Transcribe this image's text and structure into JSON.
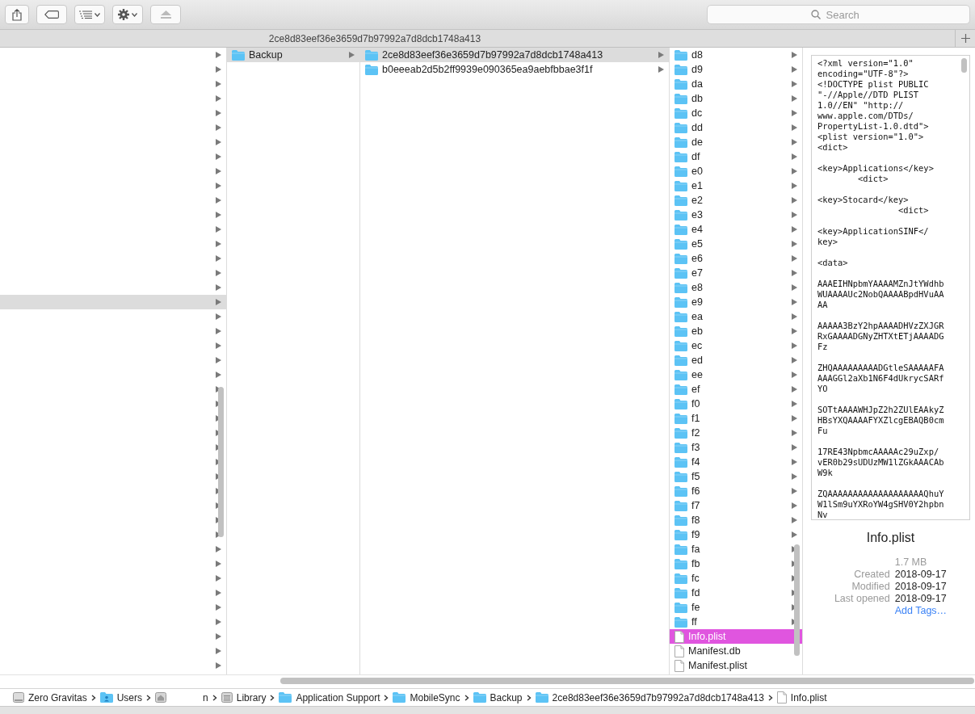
{
  "toolbar": {
    "search": {
      "placeholder": "Search"
    }
  },
  "path_title": "2ce8d83eef36e3659d7b97992a7d8dcb1748a413",
  "columns": [
    {
      "focused": false,
      "rows": [
        {
          "kind": "unnamed",
          "selected": false
        },
        {
          "kind": "unnamed",
          "selected": false
        },
        {
          "kind": "unnamed",
          "selected": false
        },
        {
          "kind": "unnamed",
          "selected": false
        },
        {
          "kind": "unnamed",
          "selected": false
        },
        {
          "kind": "unnamed",
          "selected": false
        },
        {
          "kind": "unnamed",
          "selected": false
        },
        {
          "kind": "unnamed",
          "selected": false
        },
        {
          "kind": "unnamed",
          "selected": false
        },
        {
          "kind": "unnamed",
          "selected": false
        },
        {
          "kind": "unnamed",
          "selected": false
        },
        {
          "kind": "unnamed",
          "selected": false
        },
        {
          "kind": "unnamed",
          "selected": false
        },
        {
          "kind": "unnamed",
          "selected": false
        },
        {
          "kind": "unnamed",
          "selected": false
        },
        {
          "kind": "unnamed",
          "selected": false
        },
        {
          "kind": "unnamed",
          "selected": false
        },
        {
          "kind": "unnamed",
          "selected": true
        },
        {
          "kind": "unnamed",
          "selected": false
        },
        {
          "kind": "unnamed",
          "selected": false
        },
        {
          "kind": "unnamed",
          "selected": false
        },
        {
          "kind": "unnamed",
          "selected": false
        },
        {
          "kind": "unnamed",
          "selected": false
        },
        {
          "kind": "unnamed",
          "selected": false
        },
        {
          "kind": "unnamed",
          "selected": false
        },
        {
          "kind": "unnamed",
          "selected": false
        },
        {
          "kind": "unnamed",
          "selected": false
        },
        {
          "kind": "unnamed",
          "selected": false
        },
        {
          "kind": "unnamed",
          "selected": false
        },
        {
          "kind": "unnamed",
          "selected": false
        },
        {
          "kind": "unnamed",
          "selected": false
        },
        {
          "kind": "unnamed",
          "selected": false
        },
        {
          "kind": "unnamed",
          "selected": false
        },
        {
          "kind": "unnamed",
          "selected": false
        },
        {
          "kind": "unnamed",
          "selected": false
        },
        {
          "kind": "unnamed",
          "selected": false
        },
        {
          "kind": "unnamed",
          "selected": false
        },
        {
          "kind": "unnamed",
          "selected": false
        },
        {
          "kind": "unnamed",
          "selected": false
        },
        {
          "kind": "unnamed",
          "selected": false
        },
        {
          "kind": "unnamed",
          "selected": false
        },
        {
          "kind": "unnamed",
          "selected": false
        },
        {
          "kind": "unnamed",
          "selected": false
        }
      ]
    },
    {
      "focused": false,
      "rows": [
        {
          "kind": "folder",
          "name": "Backup",
          "selected": true
        }
      ]
    },
    {
      "focused": false,
      "rows": [
        {
          "kind": "folder",
          "name": "2ce8d83eef36e3659d7b97992a7d8dcb1748a413",
          "selected": true
        },
        {
          "kind": "folder",
          "name": "b0eeeab2d5b2ff9939e090365ea9aebfbbae3f1f",
          "selected": false
        }
      ]
    },
    {
      "focused": true,
      "rows": [
        {
          "kind": "folder",
          "name": "d8",
          "selected": false
        },
        {
          "kind": "folder",
          "name": "d9",
          "selected": false
        },
        {
          "kind": "folder",
          "name": "da",
          "selected": false
        },
        {
          "kind": "folder",
          "name": "db",
          "selected": false
        },
        {
          "kind": "folder",
          "name": "dc",
          "selected": false
        },
        {
          "kind": "folder",
          "name": "dd",
          "selected": false
        },
        {
          "kind": "folder",
          "name": "de",
          "selected": false
        },
        {
          "kind": "folder",
          "name": "df",
          "selected": false
        },
        {
          "kind": "folder",
          "name": "e0",
          "selected": false
        },
        {
          "kind": "folder",
          "name": "e1",
          "selected": false
        },
        {
          "kind": "folder",
          "name": "e2",
          "selected": false
        },
        {
          "kind": "folder",
          "name": "e3",
          "selected": false
        },
        {
          "kind": "folder",
          "name": "e4",
          "selected": false
        },
        {
          "kind": "folder",
          "name": "e5",
          "selected": false
        },
        {
          "kind": "folder",
          "name": "e6",
          "selected": false
        },
        {
          "kind": "folder",
          "name": "e7",
          "selected": false
        },
        {
          "kind": "folder",
          "name": "e8",
          "selected": false
        },
        {
          "kind": "folder",
          "name": "e9",
          "selected": false
        },
        {
          "kind": "folder",
          "name": "ea",
          "selected": false
        },
        {
          "kind": "folder",
          "name": "eb",
          "selected": false
        },
        {
          "kind": "folder",
          "name": "ec",
          "selected": false
        },
        {
          "kind": "folder",
          "name": "ed",
          "selected": false
        },
        {
          "kind": "folder",
          "name": "ee",
          "selected": false
        },
        {
          "kind": "folder",
          "name": "ef",
          "selected": false
        },
        {
          "kind": "folder",
          "name": "f0",
          "selected": false
        },
        {
          "kind": "folder",
          "name": "f1",
          "selected": false
        },
        {
          "kind": "folder",
          "name": "f2",
          "selected": false
        },
        {
          "kind": "folder",
          "name": "f3",
          "selected": false
        },
        {
          "kind": "folder",
          "name": "f4",
          "selected": false
        },
        {
          "kind": "folder",
          "name": "f5",
          "selected": false
        },
        {
          "kind": "folder",
          "name": "f6",
          "selected": false
        },
        {
          "kind": "folder",
          "name": "f7",
          "selected": false
        },
        {
          "kind": "folder",
          "name": "f8",
          "selected": false
        },
        {
          "kind": "folder",
          "name": "f9",
          "selected": false
        },
        {
          "kind": "folder",
          "name": "fa",
          "selected": false
        },
        {
          "kind": "folder",
          "name": "fb",
          "selected": false
        },
        {
          "kind": "folder",
          "name": "fc",
          "selected": false
        },
        {
          "kind": "folder",
          "name": "fd",
          "selected": false
        },
        {
          "kind": "folder",
          "name": "fe",
          "selected": false
        },
        {
          "kind": "folder",
          "name": "ff",
          "selected": false
        },
        {
          "kind": "file",
          "name": "Info.plist",
          "selected": true
        },
        {
          "kind": "file",
          "name": "Manifest.db",
          "selected": false
        },
        {
          "kind": "file",
          "name": "Manifest.plist",
          "selected": false
        }
      ]
    }
  ],
  "preview": {
    "content": "<?xml version=\"1.0\"\nencoding=\"UTF-8\"?>\n<!DOCTYPE plist PUBLIC\n\"-//Apple//DTD PLIST\n1.0//EN\" \"http://\nwww.apple.com/DTDs/\nPropertyList-1.0.dtd\">\n<plist version=\"1.0\">\n<dict>\n\n<key>Applications</key>\n        <dict>\n\n<key>Stocard</key>\n                <dict>\n\n<key>ApplicationSINF</\nkey>\n\n<data>\n\nAAAEIHNpbmYAAAAMZnJtYWdhb\nWUAAAAUc2NobQAAAABpdHVuAA\nAA\n\nAAAAA3BzY2hpAAAADHVzZXJGR\nRxGAAAADGNyZHTXtETjAAAADG\nFz\n\nZHQAAAAAAAAADGtleSAAAAAFA\nAAAGGl2aXb1N6F4dUkrycSARf\nYO\n\nSOTtAAAAWHJpZ2h2ZUlEAAkyZ\nHBsYXQAAAAFYXZlcgEBAQB0cm\nFu\n\n17RE43NpbmcAAAAAc29uZxp/\nvER0b29sUDUzMW1lZGkAAACAb\nW9k\n\nZQAAAAAAAAAAAAAAAAAAAQhuY\nW1lSm9uYXRoYW4gSHV0Y2hpbn\nNv",
    "file_name": "Info.plist",
    "size": "1.7 MB",
    "details": [
      {
        "label": "Created",
        "value": "2018-09-17"
      },
      {
        "label": "Modified",
        "value": "2018-09-17"
      },
      {
        "label": "Last opened",
        "value": "2018-09-17"
      }
    ],
    "add_tags": "Add Tags…"
  },
  "breadcrumbs": [
    {
      "kind": "disk",
      "label": "Zero Gravitas"
    },
    {
      "kind": "users",
      "label": "Users"
    },
    {
      "kind": "home",
      "label": "n"
    },
    {
      "kind": "library",
      "label": "Library"
    },
    {
      "kind": "folder",
      "label": "Application Support"
    },
    {
      "kind": "folder",
      "label": "MobileSync"
    },
    {
      "kind": "folder",
      "label": "Backup"
    },
    {
      "kind": "folder",
      "label": "2ce8d83eef36e3659d7b97992a7d8dcb1748a413"
    },
    {
      "kind": "file",
      "label": "Info.plist"
    }
  ]
}
